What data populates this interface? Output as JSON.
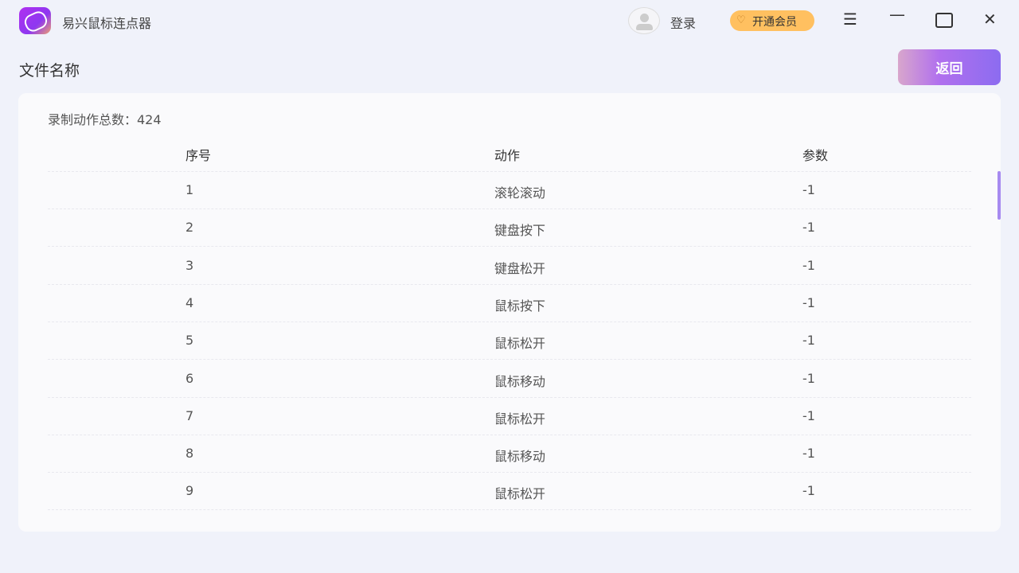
{
  "app": {
    "title": "易兴鼠标连点器",
    "login": "登录",
    "vip": "开通会员"
  },
  "page": {
    "title": "文件名称",
    "back": "返回",
    "total_label": "录制动作总数：424"
  },
  "table": {
    "headers": [
      "序号",
      "动作",
      "参数"
    ],
    "rows": [
      [
        "1",
        "滚轮滚动",
        "-1"
      ],
      [
        "2",
        "键盘按下",
        "-1"
      ],
      [
        "3",
        "键盘松开",
        "-1"
      ],
      [
        "4",
        "鼠标按下",
        "-1"
      ],
      [
        "5",
        "鼠标松开",
        "-1"
      ],
      [
        "6",
        "鼠标移动",
        "-1"
      ],
      [
        "7",
        "鼠标松开",
        "-1"
      ],
      [
        "8",
        "鼠标移动",
        "-1"
      ],
      [
        "9",
        "鼠标松开",
        "-1"
      ]
    ]
  }
}
